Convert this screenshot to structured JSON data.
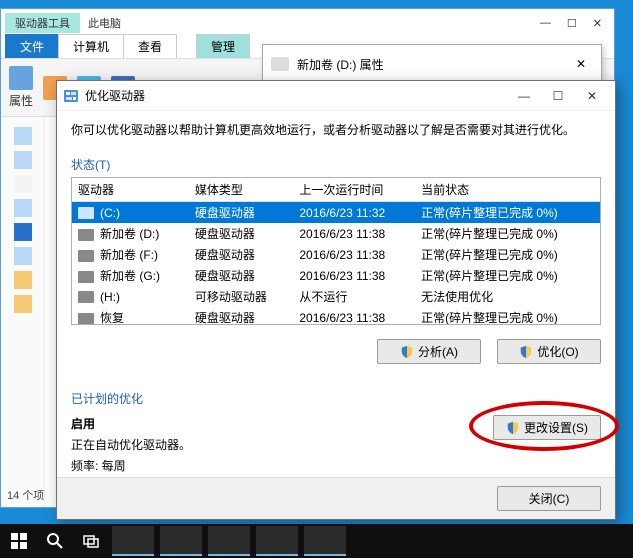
{
  "explorer": {
    "title_tool": "驱动器工具",
    "title_loc": "此电脑",
    "tabs": {
      "file": "文件",
      "computer": "计算机",
      "view": "查看",
      "manage": "管理"
    },
    "ribbon": {
      "properties": "属性"
    },
    "status": "14 个项"
  },
  "propdlg": {
    "title": "新加卷 (D:) 属性"
  },
  "opt": {
    "title": "优化驱动器",
    "desc": "你可以优化驱动器以帮助计算机更高效地运行，或者分析驱动器以了解是否需要对其进行优化。",
    "status_label": "状态(T)",
    "headers": {
      "drive": "驱动器",
      "media": "媒体类型",
      "last": "上一次运行时间",
      "current": "当前状态"
    },
    "rows": [
      {
        "name": "(C:)",
        "media": "硬盘驱动器",
        "last": "2016/6/23 11:32",
        "state": "正常(碎片整理已完成 0%)",
        "sel": true
      },
      {
        "name": "新加卷 (D:)",
        "media": "硬盘驱动器",
        "last": "2016/6/23 11:38",
        "state": "正常(碎片整理已完成 0%)"
      },
      {
        "name": "新加卷 (F:)",
        "media": "硬盘驱动器",
        "last": "2016/6/23 11:38",
        "state": "正常(碎片整理已完成 0%)"
      },
      {
        "name": "新加卷 (G:)",
        "media": "硬盘驱动器",
        "last": "2016/6/23 11:38",
        "state": "正常(碎片整理已完成 0%)"
      },
      {
        "name": "(H:)",
        "media": "可移动驱动器",
        "last": "从不运行",
        "state": "无法使用优化"
      },
      {
        "name": "恢复",
        "media": "硬盘驱动器",
        "last": "2016/6/23 11:38",
        "state": "正常(碎片整理已完成 0%)"
      }
    ],
    "buttons": {
      "analyze": "分析(A)",
      "optimize": "优化(O)",
      "change": "更改设置(S)",
      "close": "关闭(C)"
    },
    "sched": {
      "header": "已计划的优化",
      "enabled": "启用",
      "desc": "正在自动优化驱动器。",
      "freq": "频率: 每周"
    }
  }
}
